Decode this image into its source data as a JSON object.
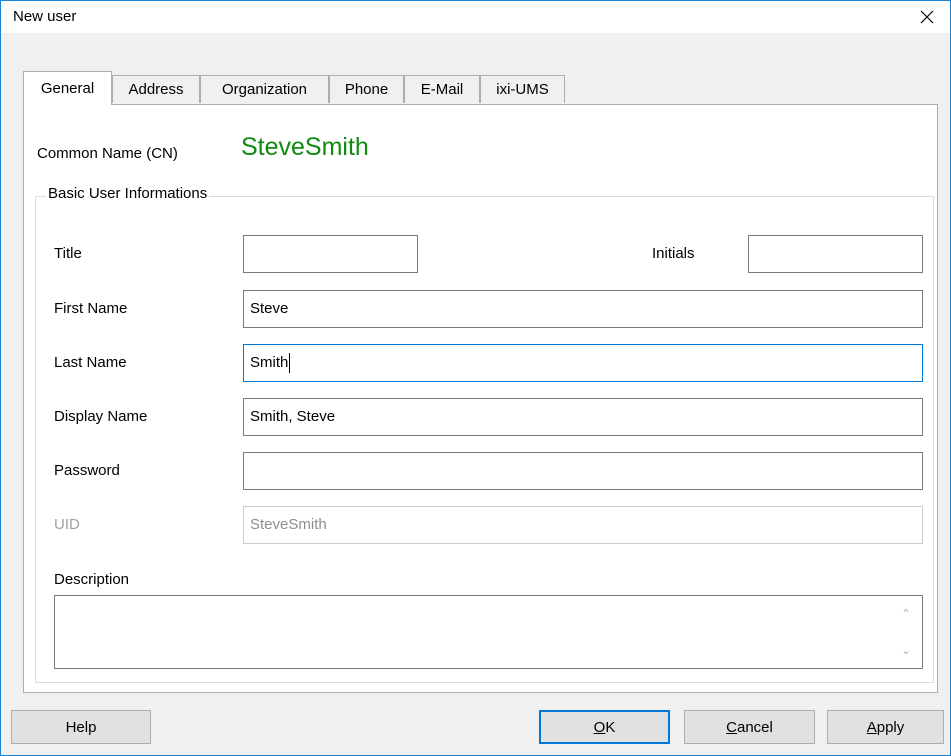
{
  "window": {
    "title": "New user"
  },
  "tabs": [
    {
      "label": "General",
      "active": true
    },
    {
      "label": "Address",
      "active": false
    },
    {
      "label": "Organization",
      "active": false
    },
    {
      "label": "Phone",
      "active": false
    },
    {
      "label": "E-Mail",
      "active": false
    },
    {
      "label": "ixi-UMS",
      "active": false
    }
  ],
  "common_name": {
    "label": "Common Name (CN)",
    "value": "SteveSmith",
    "value_color": "#108a10"
  },
  "group": {
    "legend": "Basic User Informations",
    "title": {
      "label": "Title",
      "value": ""
    },
    "initials": {
      "label": "Initials",
      "value": ""
    },
    "first_name": {
      "label": "First Name",
      "value": "Steve"
    },
    "last_name": {
      "label": "Last Name",
      "value": "Smith"
    },
    "display_name": {
      "label": "Display Name",
      "value": "Smith, Steve"
    },
    "password": {
      "label": "Password",
      "value": ""
    },
    "uid": {
      "label": "UID",
      "value": "SteveSmith"
    },
    "description": {
      "label": "Description",
      "value": ""
    }
  },
  "buttons": {
    "help": "Help",
    "ok_mnemonic": "O",
    "ok_rest": "K",
    "cancel_mnemonic": "C",
    "cancel_rest": "ancel",
    "apply_mnemonic": "A",
    "apply_rest": "pply"
  },
  "colors": {
    "accent": "#0078d7",
    "window_border": "#1883d7"
  }
}
